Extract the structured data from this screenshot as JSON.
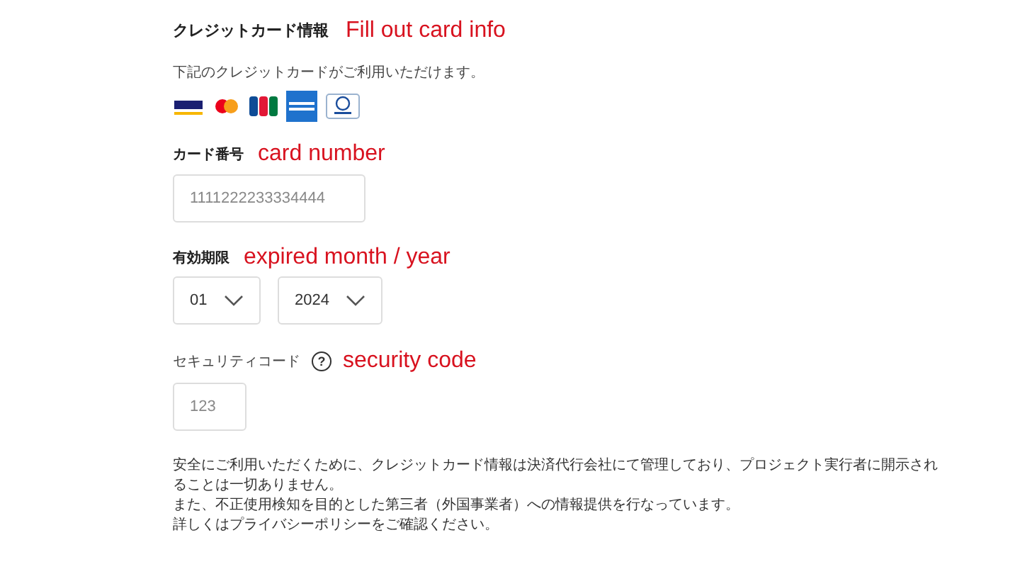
{
  "section_title": "クレジットカード情報",
  "annotation_title": "Fill out card info",
  "accepted_text": "下記のクレジットカードがご利用いただけます。",
  "card_brands": [
    {
      "kind": "visa"
    },
    {
      "kind": "mastercard"
    },
    {
      "kind": "jcb"
    },
    {
      "kind": "amex"
    },
    {
      "kind": "diners"
    }
  ],
  "card_number": {
    "label": "カード番号",
    "annotation": "card number",
    "placeholder": "1111222233334444"
  },
  "expiry": {
    "label": "有効期限",
    "annotation": "expired month / year",
    "month": "01",
    "year": "2024"
  },
  "security_code": {
    "label": "セキュリティコード",
    "help": "?",
    "annotation": "security code",
    "placeholder": "123"
  },
  "notes": [
    "安全にご利用いただくために、クレジットカード情報は決済代行会社にて管理しており、プロジェクト実行者に開示されることは一切ありません。",
    "また、不正使用検知を目的とした第三者（外国事業者）への情報提供を行なっています。",
    "詳しくはプライバシーポリシーをご確認ください。"
  ]
}
